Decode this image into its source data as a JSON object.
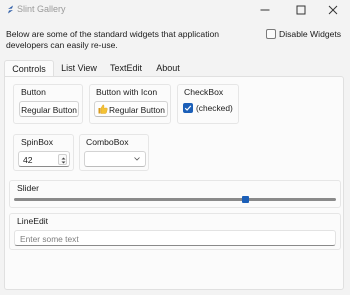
{
  "window": {
    "title": "Slint Gallery",
    "controls": [
      "minimize-icon",
      "maximize-icon",
      "close-icon"
    ]
  },
  "intro": {
    "text": "Below are some of the standard widgets that application developers can easily re-use.",
    "disable_widgets_label": "Disable Widgets",
    "disable_widgets_checked": false
  },
  "tabs": [
    {
      "label": "Controls",
      "active": true
    },
    {
      "label": "List View",
      "active": false
    },
    {
      "label": "TextEdit",
      "active": false
    },
    {
      "label": "About",
      "active": false
    }
  ],
  "controls": {
    "button_group": {
      "title": "Button",
      "button_label": "Regular Button"
    },
    "icon_button_group": {
      "title": "Button with Icon",
      "button_label": "Regular Button",
      "icon": "thumbs-up-icon"
    },
    "checkbox_group": {
      "title": "CheckBox",
      "checkbox_label": "(checked)",
      "checked": true
    },
    "spinbox_group": {
      "title": "SpinBox",
      "value": "42"
    },
    "combobox_group": {
      "title": "ComboBox",
      "value": ""
    },
    "slider_group": {
      "title": "Slider",
      "value_fraction": 0.72
    },
    "lineedit_group": {
      "title": "LineEdit",
      "placeholder": "Enter some text",
      "value": ""
    }
  },
  "colors": {
    "accent": "#1b5fb8",
    "window_bg": "#f3f3f3",
    "panel_bg": "#fbfbfb"
  }
}
